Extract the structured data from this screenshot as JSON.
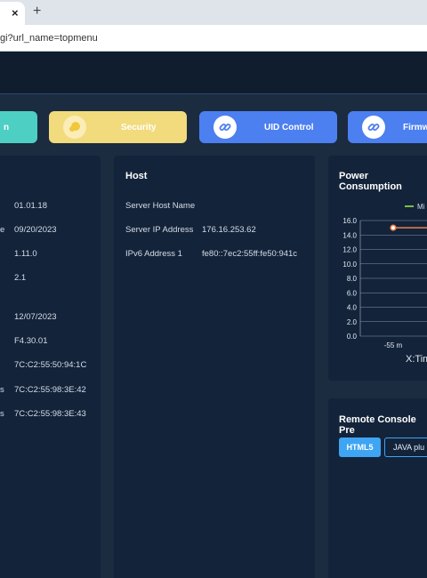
{
  "browser": {
    "tab_close_glyph": "×",
    "new_tab_glyph": "+",
    "url": "gi?url_name=topmenu"
  },
  "quick_buttons": {
    "first_label": "n",
    "security_label": "Security",
    "uid_label": "UID Control",
    "firmware_label": "Firmw"
  },
  "system_info": {
    "values": [
      "01.01.18",
      "09/20/2023",
      "1.11.0",
      "2.1",
      "12/07/2023",
      "F4.30.01",
      "7C:C2:55:50:94:1C",
      "7C:C2:55:98:3E:42",
      "7C:C2:55:98:3E:43"
    ],
    "label_tails": [
      "e",
      "s",
      "s"
    ]
  },
  "host": {
    "title": "Host",
    "server_host_name_label": "Server Host Name",
    "server_ip_label": "Server IP Address",
    "server_ip_value": "176.16.253.62",
    "ipv6_label": "IPv6 Address 1",
    "ipv6_value": "fe80::7ec2:55ff:fe50:941c"
  },
  "power": {
    "title": "Power Consumption",
    "legend_label": "Mi",
    "legend_color": "#7ac043",
    "line_color": "#e8834a"
  },
  "chart_data": {
    "type": "line",
    "title": "Power Consumption",
    "xlabel": "X:Tim",
    "x_tick_labels": [
      "-55 m"
    ],
    "y_ticks": [
      "16.0",
      "14.0",
      "12.0",
      "10.0",
      "8.0",
      "6.0",
      "4.0",
      "2.0",
      "0.0"
    ],
    "ylim": [
      0,
      16
    ],
    "grid": true,
    "series": [
      {
        "name": "Mi",
        "x": [
          "-55 m"
        ],
        "values": [
          15.0
        ]
      }
    ]
  },
  "console": {
    "title": "Remote Console Pre",
    "html5_label": "HTML5",
    "java_label": "JAVA plu"
  }
}
